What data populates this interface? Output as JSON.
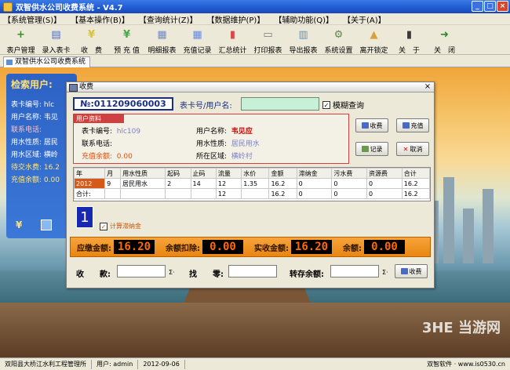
{
  "app": {
    "title": "双智供水公司收费系统 - V4.7"
  },
  "window_buttons": [
    "_",
    "□",
    "×"
  ],
  "menu": [
    "【系统管理(S)】",
    "【基本操作(B)】",
    "【查询统计(Z)】",
    "【数据维护(P)】",
    "【辅助功能(Q)】",
    "【关于(A)】"
  ],
  "toolbar": [
    {
      "label": "表户管理",
      "icon": "user-add-icon",
      "color": "#3a8a2a",
      "glyph": "+"
    },
    {
      "label": "录入表卡",
      "icon": "card-icon",
      "color": "#4a6ac8",
      "glyph": "▤"
    },
    {
      "label": "收　费",
      "icon": "yen-icon",
      "color": "#d8c23a",
      "glyph": "¥"
    },
    {
      "label": "预 充 值",
      "icon": "prepay-icon",
      "color": "#4aa84a",
      "glyph": "¥"
    },
    {
      "label": "明细报表",
      "icon": "grid-icon",
      "color": "#6a8ad8",
      "glyph": "▦"
    },
    {
      "label": "充值记录",
      "icon": "grid2-icon",
      "color": "#6a8ad8",
      "glyph": "▦"
    },
    {
      "label": "汇总统计",
      "icon": "chart-icon",
      "color": "#d84a4a",
      "glyph": "▮"
    },
    {
      "label": "打印报表",
      "icon": "printer-icon",
      "color": "#7a7a7a",
      "glyph": "▭"
    },
    {
      "label": "导出报表",
      "icon": "export-icon",
      "color": "#4a9ad8",
      "glyph": "▥"
    },
    {
      "label": "系统设置",
      "icon": "settings-icon",
      "color": "#5a8a4a",
      "glyph": "⚙"
    },
    {
      "label": "离开锁定",
      "icon": "lock-icon",
      "color": "#d8a03a",
      "glyph": "▲"
    },
    {
      "label": "关　于",
      "icon": "about-icon",
      "color": "#3a3a3a",
      "glyph": "▮"
    },
    {
      "label": "关　闭",
      "icon": "exit-icon",
      "color": "#2a8a2a",
      "glyph": "➜"
    }
  ],
  "tab": {
    "label": "双智供水公司收费系统"
  },
  "left_panel": {
    "title": "检索用户:",
    "rows": [
      {
        "text": "表卡编号: hlc",
        "cls": ""
      },
      {
        "text": "用户名称: 韦见",
        "cls": ""
      },
      {
        "text": "联系电话:",
        "cls": "red"
      },
      {
        "text": "用水性质: 居民",
        "cls": ""
      },
      {
        "text": "用水区域: 横岭",
        "cls": ""
      },
      {
        "text": "待交水费: 16.2",
        "cls": "yellow"
      },
      {
        "text": "充值余额: 0.00",
        "cls": "yellow"
      }
    ]
  },
  "dialog": {
    "title": "收费",
    "card_no": "№:011209060003",
    "card_label": "表卡号/用户名:",
    "card_input": "",
    "fuzzy_label": "模糊查询",
    "user_box": {
      "header": "用户资料",
      "card_label": "表卡编号:",
      "card_value": "hlc109",
      "name_label": "用户名称:",
      "name_value": "韦见应",
      "phone_label": "联系电话:",
      "phone_value": "",
      "nature_label": "用水性质:",
      "nature_value": "居民用水",
      "balance_label": "充值余额:",
      "balance_value": "0.00",
      "area_label": "所在区域:",
      "area_value": "横岭村"
    },
    "buttons": {
      "charge": "收费",
      "recharge": "充值",
      "record": "记录",
      "cancel": "取消",
      "charge2": "收费"
    },
    "table": {
      "headers": [
        "年",
        "月",
        "用水性质",
        "起码",
        "止码",
        "流量",
        "水价",
        "金额",
        "滞纳金",
        "污水费",
        "资源费",
        "合计"
      ],
      "rows": [
        [
          "2012",
          "9",
          "居民用水",
          "2",
          "14",
          "12",
          "1.35",
          "16.2",
          "0",
          "0",
          "0",
          "16.2"
        ],
        [
          "合计:",
          "",
          "",
          "",
          "",
          "12",
          "",
          "16.2",
          "0",
          "0",
          "0",
          "16.2"
        ]
      ]
    },
    "count": "1",
    "calc_late_fee": "计算滞纳金",
    "amounts": {
      "due_label": "应缴金额:",
      "due": "16.20",
      "deduct_label": "余额扣除:",
      "deduct": "0.00",
      "paid_label": "实收金额:",
      "paid": "16.20",
      "remain_label": "余额:",
      "remain": "0.00"
    },
    "bottom": {
      "receive_label": "收　　款:",
      "change_label": "找　　零:",
      "transfer_label": "转存余额:",
      "sigma": "Σ·"
    }
  },
  "status": {
    "org": "双阳县大桥江水利工程管理所",
    "user": "用户: admin",
    "date": "2012-09-06",
    "vendor": "双智软件 · www.is0530.cn"
  },
  "watermark": "3HE 当游网"
}
